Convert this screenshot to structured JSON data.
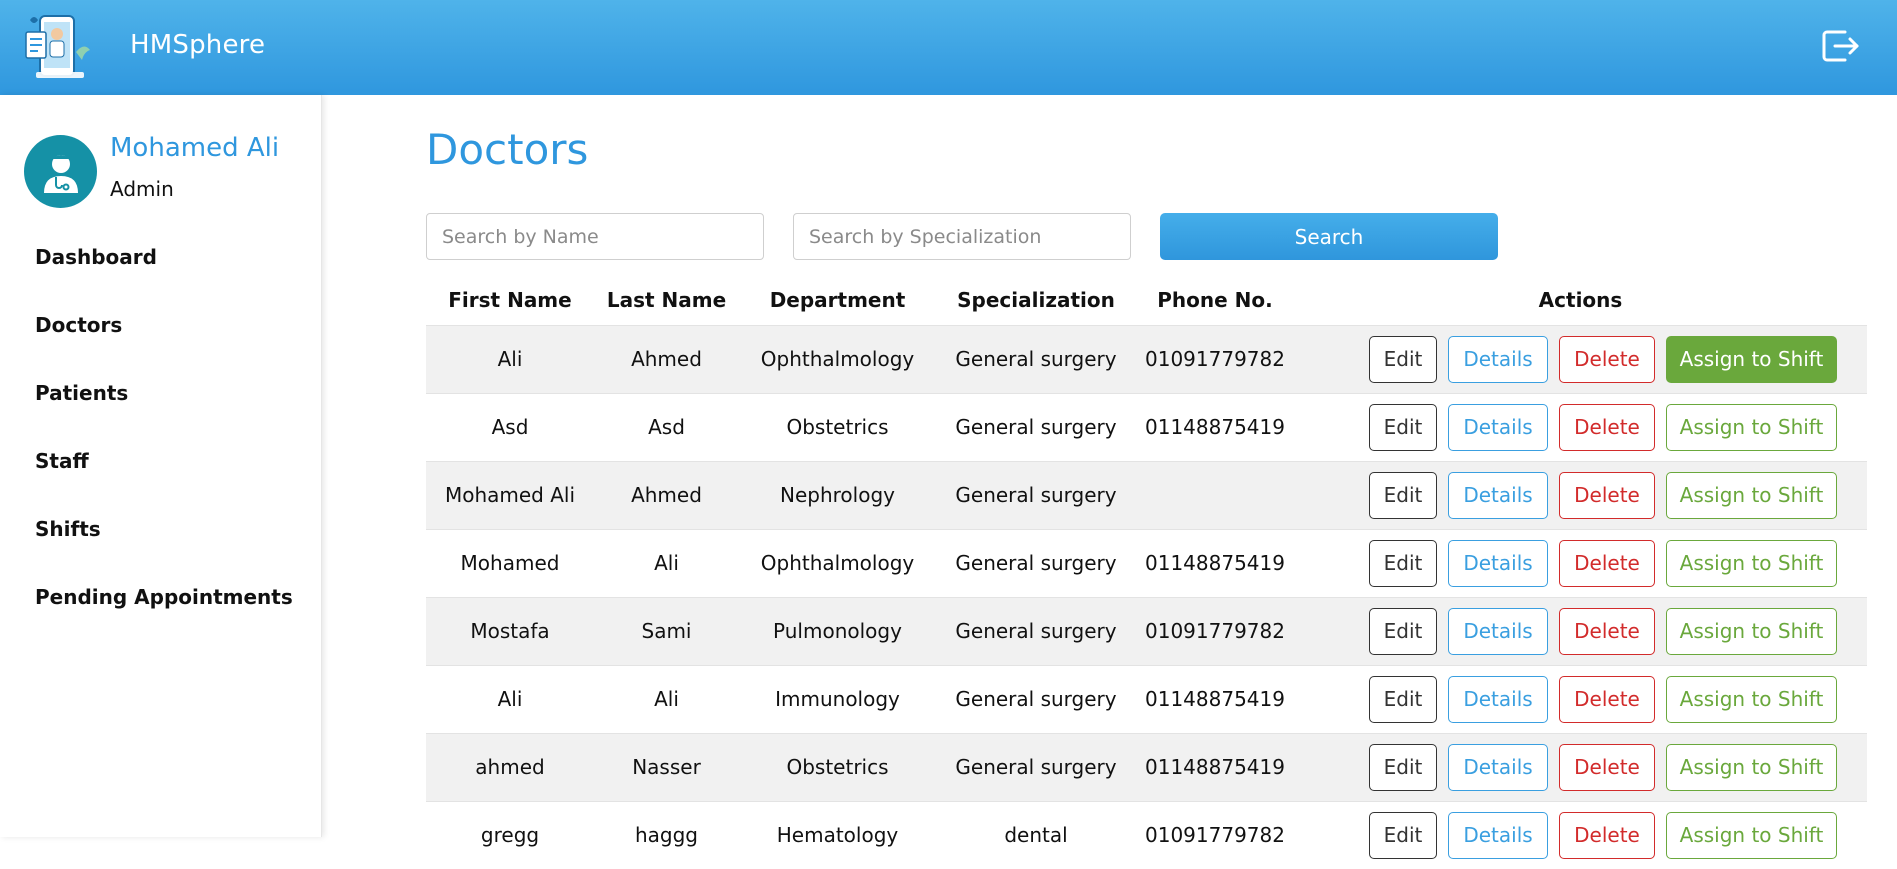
{
  "app": {
    "brand": "HMSphere"
  },
  "user": {
    "name": "Mohamed Ali",
    "role": "Admin"
  },
  "nav": [
    "Dashboard",
    "Doctors",
    "Patients",
    "Staff",
    "Shifts",
    "Pending Appointments"
  ],
  "page": {
    "title": "Doctors"
  },
  "search": {
    "name_placeholder": "Search by Name",
    "spec_placeholder": "Search by Specialization",
    "button": "Search"
  },
  "table": {
    "headers": [
      "First Name",
      "Last Name",
      "Department",
      "Specialization",
      "Phone No.",
      "Actions"
    ],
    "actions": {
      "edit": "Edit",
      "details": "Details",
      "delete": "Delete",
      "assign": "Assign to Shift"
    },
    "rows": [
      {
        "first": "Ali",
        "last": "Ahmed",
        "dept": "Ophthalmology",
        "spec": "General surgery",
        "phone": "01091779782",
        "assign_active": true
      },
      {
        "first": "Asd",
        "last": "Asd",
        "dept": "Obstetrics",
        "spec": "General surgery",
        "phone": "01148875419",
        "assign_active": false
      },
      {
        "first": "Mohamed Ali",
        "last": "Ahmed",
        "dept": "Nephrology",
        "spec": "General surgery",
        "phone": "",
        "assign_active": false
      },
      {
        "first": "Mohamed",
        "last": "Ali",
        "dept": "Ophthalmology",
        "spec": "General surgery",
        "phone": "01148875419",
        "assign_active": false
      },
      {
        "first": "Mostafa",
        "last": "Sami",
        "dept": "Pulmonology",
        "spec": "General surgery",
        "phone": "01091779782",
        "assign_active": false
      },
      {
        "first": "Ali",
        "last": "Ali",
        "dept": "Immunology",
        "spec": "General surgery",
        "phone": "01148875419",
        "assign_active": false
      },
      {
        "first": "ahmed",
        "last": "Nasser",
        "dept": "Obstetrics",
        "spec": "General surgery",
        "phone": "01148875419",
        "assign_active": false
      },
      {
        "first": "gregg",
        "last": "haggg",
        "dept": "Hematology",
        "spec": "dental",
        "phone": "01091779782",
        "assign_active": false
      }
    ]
  },
  "icons": {
    "logo": "doctor-clipboard-logo",
    "logout": "logout-icon",
    "avatar": "doctor-avatar-icon"
  },
  "colors": {
    "primary": "#2f97de",
    "success": "#6aa83c",
    "danger": "#d22b2b",
    "avatar": "#1591a6"
  }
}
